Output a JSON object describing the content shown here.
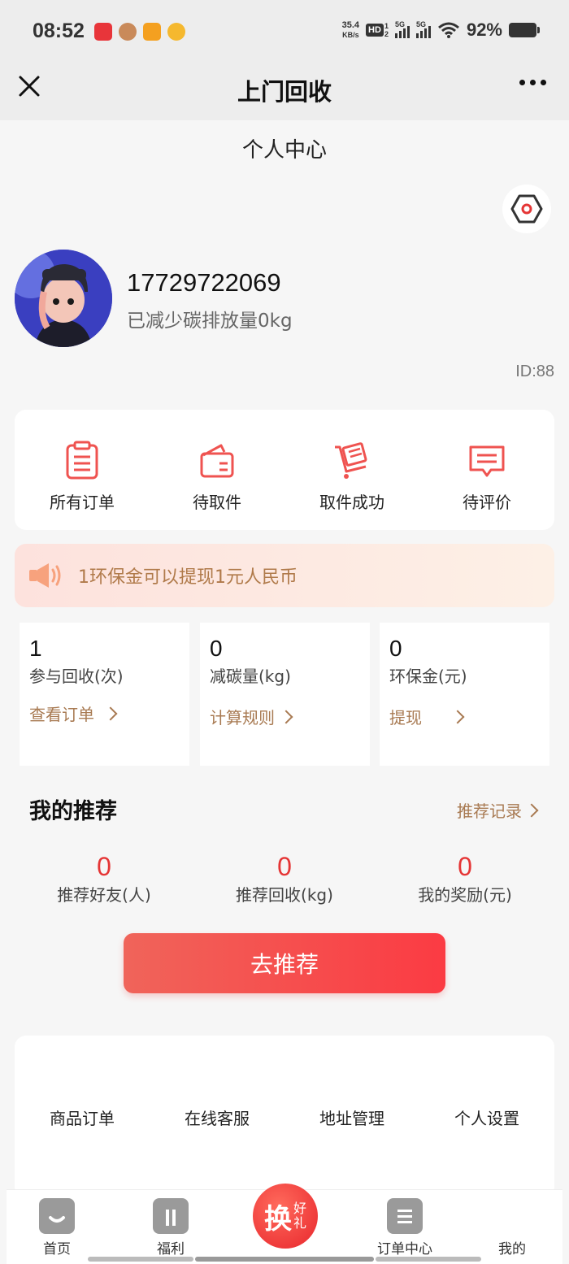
{
  "status_bar": {
    "time": "08:52",
    "net_speed_value": "35.4",
    "net_speed_unit": "KB/s",
    "hd_badge": "HD",
    "sim_slot": "1",
    "sim_slot2": "2",
    "network_1": "5G",
    "network_2": "5G",
    "battery_pct": "92%"
  },
  "nav": {
    "title": "上门回收"
  },
  "page": {
    "title": "个人中心"
  },
  "profile": {
    "phone": "17729722069",
    "carbon_text": "已减少碳排放量0kg",
    "id_text": "ID:88"
  },
  "orders": [
    {
      "label": "所有订单",
      "icon": "clipboard-icon"
    },
    {
      "label": "待取件",
      "icon": "wallet-icon"
    },
    {
      "label": "取件成功",
      "icon": "cart-icon"
    },
    {
      "label": "待评价",
      "icon": "comment-icon"
    }
  ],
  "notice": {
    "text": "1环保金可以提现1元人民币"
  },
  "stats": [
    {
      "value": "1",
      "name": "参与回收(次)",
      "link": "查看订单"
    },
    {
      "value": "0",
      "name": "减碳量(kg)",
      "link": "计算规则"
    },
    {
      "value": "0",
      "name": "环保金(元)",
      "link": "提现"
    }
  ],
  "recommend": {
    "title": "我的推荐",
    "record_link": "推荐记录",
    "stats": [
      {
        "value": "0",
        "name": "推荐好友(人)"
      },
      {
        "value": "0",
        "name": "推荐回收(kg)"
      },
      {
        "value": "0",
        "name": "我的奖励(元)"
      }
    ],
    "button": "去推荐"
  },
  "more": [
    "商品订单",
    "在线客服",
    "地址管理",
    "个人设置"
  ],
  "tabbar": {
    "home": "首页",
    "welfare": "福利",
    "center_big": "换",
    "center_small_1": "好",
    "center_small_2": "礼",
    "orders": "订单中心",
    "mine": "我的"
  },
  "colors": {
    "accent_red": "#e53535",
    "link_brown": "#a87a52",
    "icon_red": "#ef5350"
  }
}
